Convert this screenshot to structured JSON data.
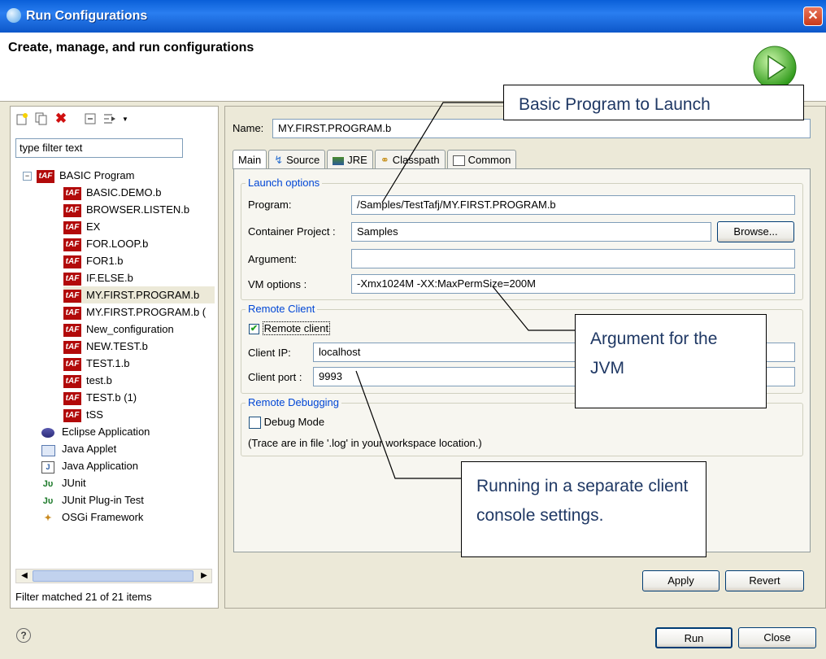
{
  "window": {
    "title": "Run Configurations",
    "subtitle": "Create, manage, and run configurations",
    "close_glyph": "✕"
  },
  "left": {
    "filter_placeholder": "type filter text",
    "tree": {
      "root": "BASIC Program",
      "taf_badge": "tAF",
      "programs": [
        "BASIC.DEMO.b",
        "BROWSER.LISTEN.b",
        "EX",
        "FOR.LOOP.b",
        "FOR1.b",
        "IF.ELSE.b",
        "MY.FIRST.PROGRAM.b",
        "MY.FIRST.PROGRAM.b (",
        "New_configuration",
        "NEW.TEST.b",
        "TEST.1.b",
        "test.b",
        "TEST.b (1)",
        "tSS"
      ],
      "categories": [
        "Eclipse Application",
        "Java Applet",
        "Java Application",
        "JUnit",
        "JUnit Plug-in Test",
        "OSGi Framework"
      ]
    },
    "status": "Filter matched 21 of 21 items"
  },
  "main": {
    "name_label": "Name:",
    "name_value": "MY.FIRST.PROGRAM.b",
    "tabs": [
      "Main",
      "Source",
      "JRE",
      "Classpath",
      "Common"
    ],
    "launch_group": "Launch options",
    "program_label": "Program:",
    "program_value": "/Samples/TestTafj/MY.FIRST.PROGRAM.b",
    "container_label": "Container Project :",
    "container_value": "Samples",
    "browse_label": "Browse...",
    "argument_label": "Argument:",
    "argument_value": "",
    "vm_label": "VM options :",
    "vm_value": "-Xmx1024M -XX:MaxPermSize=200M",
    "remote_group": "Remote Client",
    "remote_checkbox": "Remote client",
    "client_ip_label": "Client IP:",
    "client_ip_value": "localhost",
    "client_port_label": "Client port :",
    "client_port_value": "9993",
    "debug_group": "Remote Debugging",
    "debug_checkbox": "Debug Mode",
    "trace_note": "(Trace are in file '.log' in your workspace location.)",
    "apply_label": "Apply",
    "revert_label": "Revert"
  },
  "footer": {
    "help_glyph": "?",
    "run_label": "Run",
    "close_label": "Close"
  },
  "callouts": {
    "program": "Basic Program to Launch",
    "jvm": "Argument for the JVM",
    "client": "Running in a separate client console settings."
  }
}
